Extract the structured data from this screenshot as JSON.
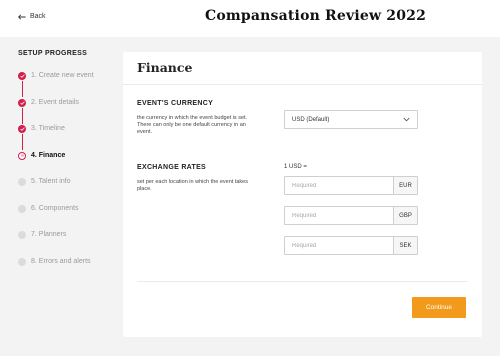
{
  "header": {
    "back_label": "Back",
    "title": "Compansation Review 2022"
  },
  "sidebar": {
    "heading": "SETUP PROGRESS",
    "steps": [
      {
        "label": "1. Create new event",
        "status": "done"
      },
      {
        "label": "2. Event details",
        "status": "done"
      },
      {
        "label": "3. Timeline",
        "status": "done"
      },
      {
        "label": "4. Finance",
        "status": "current"
      },
      {
        "label": "5. Talent info",
        "status": "todo"
      },
      {
        "label": "6. Components",
        "status": "todo"
      },
      {
        "label": "7. Planners",
        "status": "todo"
      },
      {
        "label": "8. Errors and alerts",
        "status": "todo"
      }
    ]
  },
  "finance": {
    "title": "Finance",
    "currency": {
      "heading": "EVENT'S CURRENCY",
      "description": "the currency in which the event budget is set. There can only be one default currency in an event.",
      "selected": "USD (Default)"
    },
    "rates": {
      "heading": "EXCHANGE RATES",
      "description": "set per each location in which the event takes place.",
      "base_label": "1 USD =",
      "items": [
        {
          "currency": "EUR",
          "placeholder": "Required",
          "value": ""
        },
        {
          "currency": "GBP",
          "placeholder": "Required",
          "value": ""
        },
        {
          "currency": "SEK",
          "placeholder": "Required",
          "value": ""
        }
      ]
    },
    "continue_label": "Continue"
  },
  "colors": {
    "accent": "#d21f4c",
    "button": "#f29a1b",
    "background": "#f4f3f4"
  }
}
